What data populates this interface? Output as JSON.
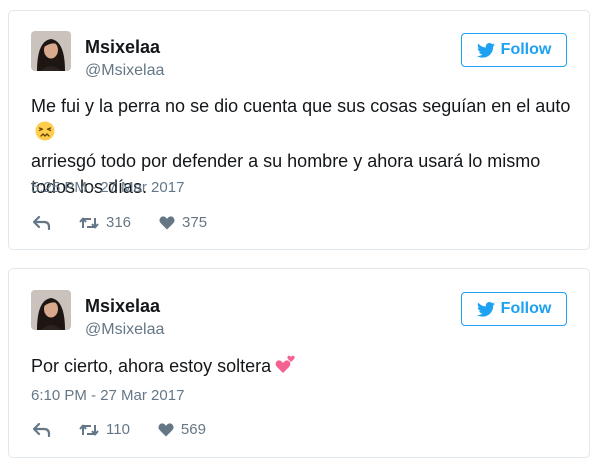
{
  "tweets": [
    {
      "name": "Msixelaa",
      "handle": "@Msixelaa",
      "follow_label": "Follow",
      "text_lines": [
        "Me fui y la perra no se dio cuenta que sus cosas seguían en el auto",
        "arriesgó todo por defender a su hombre y ahora usará lo mismo",
        "todos los días."
      ],
      "emoji": "persevering-face",
      "timestamp": "5:25 PM - 27 Mar 2017",
      "retweets": "316",
      "likes": "375"
    },
    {
      "name": "Msixelaa",
      "handle": "@Msixelaa",
      "follow_label": "Follow",
      "text": "Por cierto, ahora estoy soltera",
      "emoji": "two-hearts",
      "timestamp": "6:10 PM - 27 Mar 2017",
      "retweets": "110",
      "likes": "569"
    }
  ],
  "colors": {
    "brand": "#1da1f2",
    "text": "#14171a",
    "muted": "#657786",
    "border": "#e1e8ed"
  }
}
